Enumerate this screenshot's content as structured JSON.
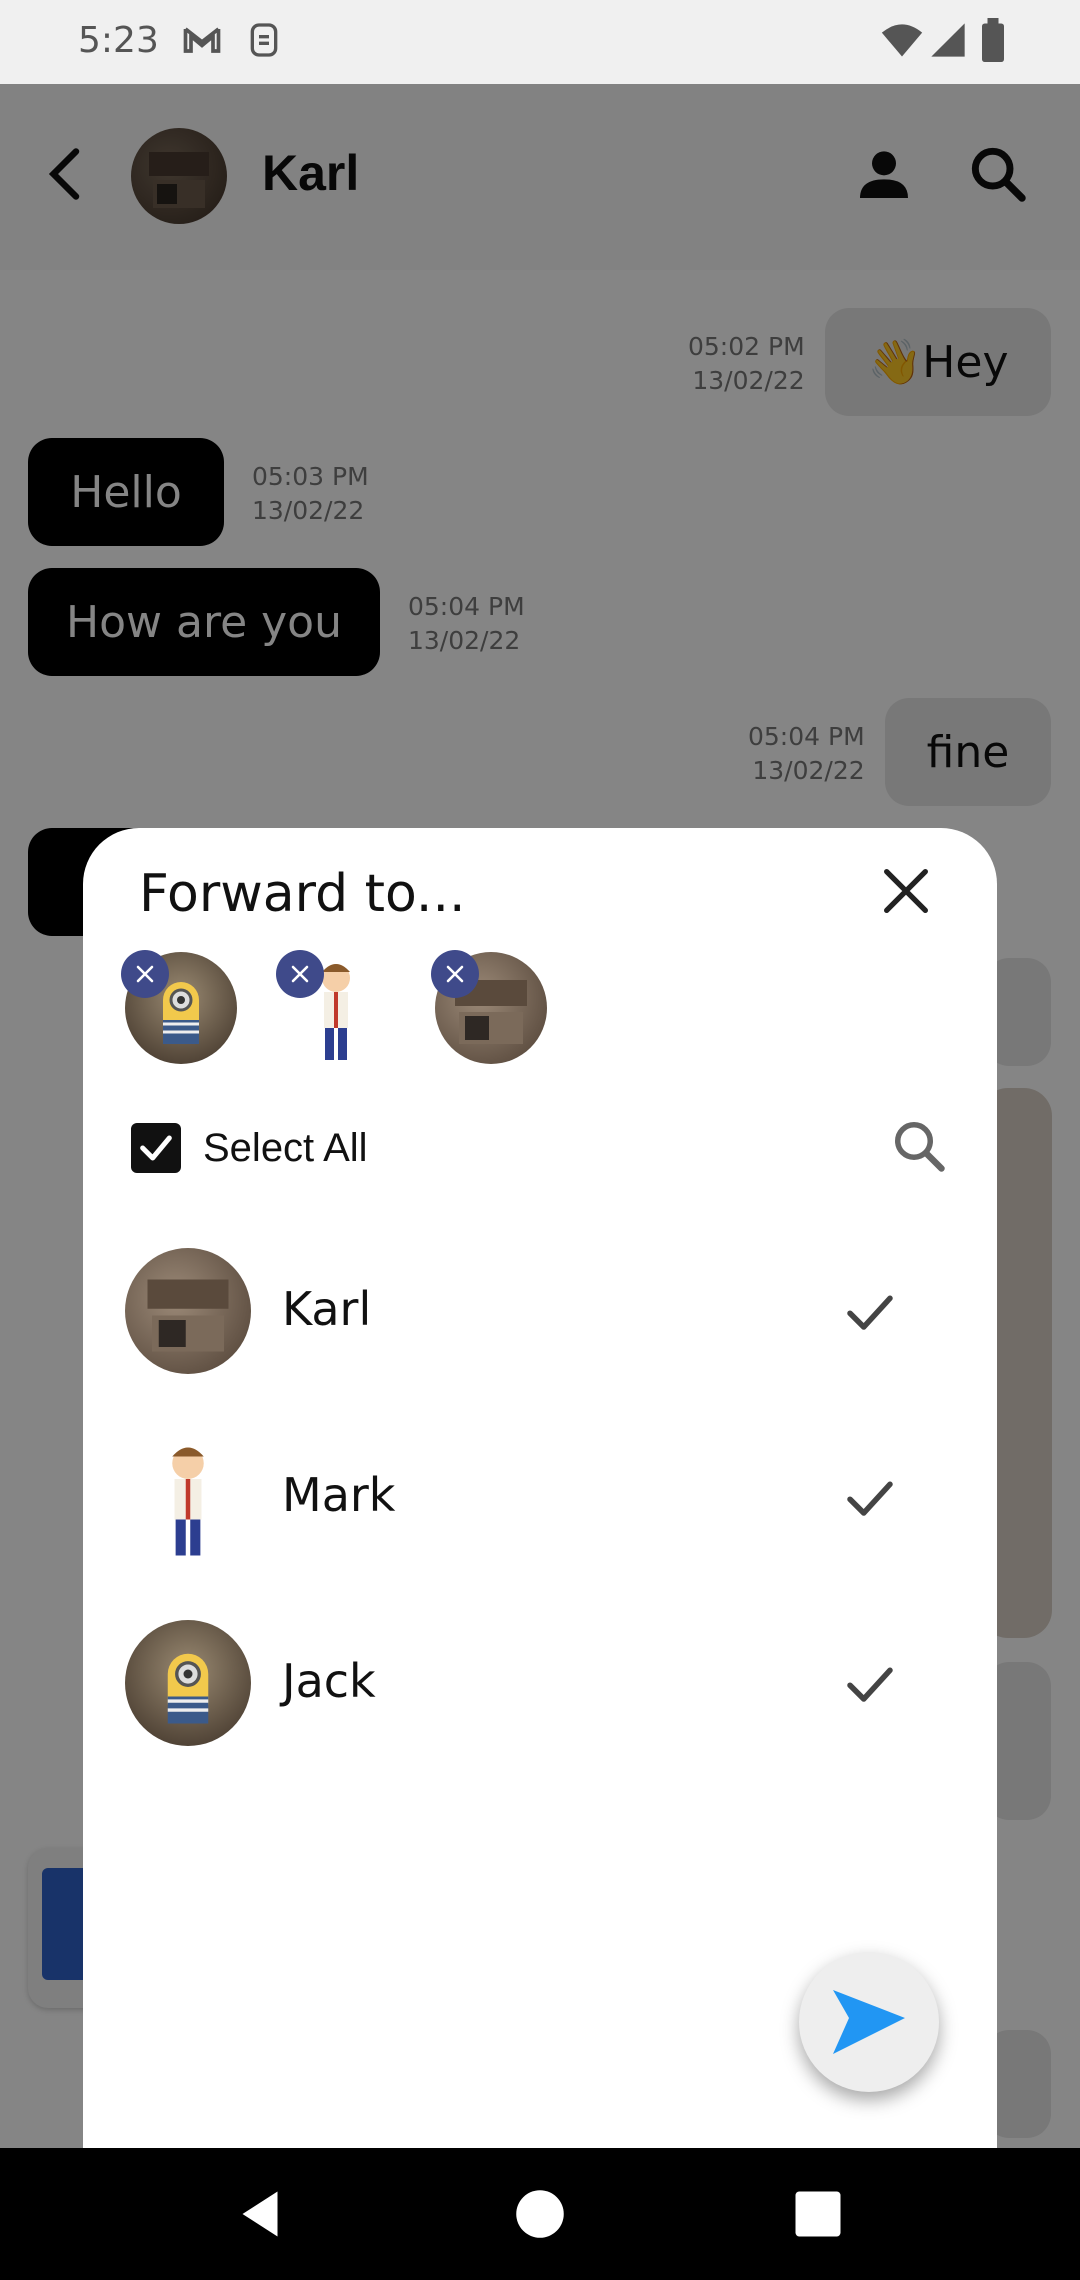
{
  "status_bar": {
    "time": "5:23",
    "icons": [
      "gmail-icon",
      "sim-icon",
      "wifi-icon",
      "signal-icon",
      "battery-icon"
    ]
  },
  "app_bar": {
    "title": "Karl",
    "icons": [
      "back-arrow-icon",
      "profile-icon",
      "search-icon"
    ]
  },
  "messages": [
    {
      "direction": "out",
      "text": "👋Hey",
      "time": "05:02 PM",
      "date": "13/02/22"
    },
    {
      "direction": "in",
      "text": "Hello",
      "time": "05:03 PM",
      "date": "13/02/22"
    },
    {
      "direction": "in",
      "text": "How are you",
      "time": "05:04 PM",
      "date": "13/02/22"
    },
    {
      "direction": "out",
      "text": "fine",
      "time": "05:04 PM",
      "date": "13/02/22"
    }
  ],
  "dialog": {
    "title": "Forward to...",
    "select_all_label": "Select All",
    "select_all_checked": true,
    "selected_chips": [
      {
        "avatar": "minion-avatar"
      },
      {
        "avatar": "cartoon-boy-avatar"
      },
      {
        "avatar": "kitchen-avatar"
      }
    ],
    "contacts": [
      {
        "name": "Karl",
        "avatar": "kitchen-avatar",
        "selected": true
      },
      {
        "name": "Mark",
        "avatar": "cartoon-boy-avatar",
        "selected": true
      },
      {
        "name": "Jack",
        "avatar": "minion-avatar",
        "selected": true
      }
    ]
  },
  "colors": {
    "accent_send": "#2196f3",
    "chip_remove": "#3f4a8a",
    "overlay": "rgba(0,0,0,0.48)"
  }
}
